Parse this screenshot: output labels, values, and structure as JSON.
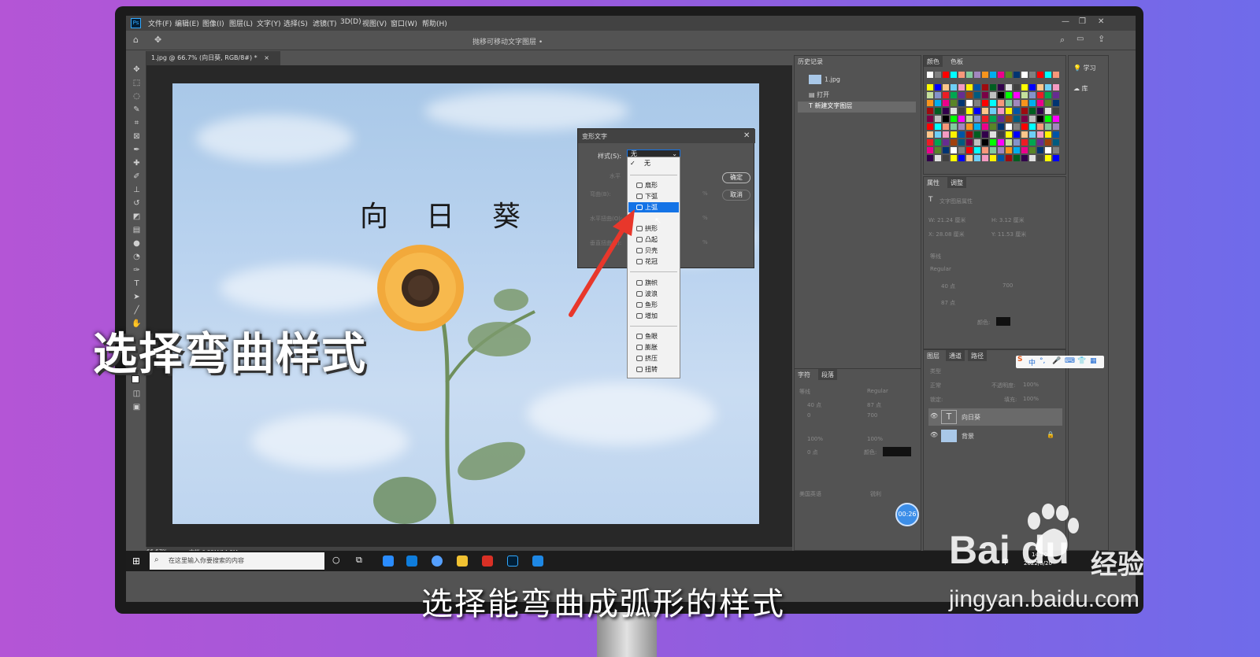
{
  "menubar": {
    "app_icon": "Ps",
    "items": [
      "文件(F)",
      "编辑(E)",
      "图像(I)",
      "图层(L)",
      "文字(Y)",
      "选择(S)",
      "滤镜(T)",
      "3D(D)",
      "视图(V)",
      "窗口(W)",
      "帮助(H)"
    ]
  },
  "optbar": {
    "center_title": "抛移可移动文字图层 •"
  },
  "document": {
    "tab_label": "1.jpg @ 66.7% (向日葵, RGB/8#) *",
    "canvas_text": "向日葵",
    "zoom": "66.67%",
    "doc_size": "文档:6.25M/14.2M"
  },
  "dialog": {
    "title": "变形文字",
    "style_label": "样式(S):",
    "style_value": "无",
    "ok": "确定",
    "cancel": "取消",
    "faded": [
      "水平",
      "弯曲(B):",
      "水平扭曲(O):",
      "垂直扭曲(E):",
      "%",
      "%",
      "%"
    ]
  },
  "dropdown": {
    "items": [
      {
        "label": "无",
        "checked": true
      },
      {
        "label": "扇形"
      },
      {
        "label": "下弧"
      },
      {
        "label": "上弧",
        "selected": true
      },
      {
        "label": "拱形"
      },
      {
        "label": "凸起"
      },
      {
        "label": "贝壳"
      },
      {
        "label": "花冠"
      },
      {
        "label": "旗帜"
      },
      {
        "label": "波浪"
      },
      {
        "label": "鱼形"
      },
      {
        "label": "增加"
      },
      {
        "label": "鱼眼"
      },
      {
        "label": "膨胀"
      },
      {
        "label": "挤压"
      },
      {
        "label": "扭转"
      }
    ]
  },
  "panels": {
    "history": {
      "tab": "历史记录",
      "items": [
        "1.jpg",
        "打开",
        "新建文字图层"
      ]
    },
    "swatches": {
      "tabs": [
        "颜色",
        "色板"
      ]
    },
    "learn": {
      "items": [
        "学习",
        "库"
      ]
    },
    "properties": {
      "tabs": [
        "属性",
        "调整"
      ],
      "section": "文字图层属性",
      "w": "W: 21.24 厘米",
      "h": "H: 3.12 厘米",
      "x": "X: 28.08 厘米",
      "y": "Y: 11.53 厘米",
      "font": "等线",
      "style": "Regular",
      "size": "40 点",
      "tracking": "700",
      "leading": "87 点",
      "color_label": "颜色:"
    },
    "character": {
      "tabs": [
        "字符",
        "段落"
      ],
      "font": "等线",
      "style": "Regular",
      "size": "40 点",
      "leading": "87 点",
      "kerning": "0",
      "tracking": "700",
      "vscale": "100%",
      "hscale": "100%",
      "baseline": "0 点",
      "color_label": "颜色:",
      "lang": "美国英语",
      "aa": "锐利"
    },
    "layers": {
      "tabs": [
        "图层",
        "通道",
        "路径"
      ],
      "search": "类型",
      "blend": "正常",
      "opacity_label": "不透明度:",
      "opacity": "100%",
      "lock_label": "锁定:",
      "fill_label": "填充:",
      "fill": "100%",
      "items": [
        {
          "name": "向日葵",
          "type": "text"
        },
        {
          "name": "背景",
          "type": "image"
        }
      ]
    }
  },
  "ime": {
    "items": [
      "中",
      "°,"
    ]
  },
  "taskbar": {
    "search_placeholder": "在这里输入你要搜索的内容",
    "clock_time": "14:20",
    "clock_date": "2022/8/20",
    "ime_label": "中"
  },
  "timer": "00:26",
  "overlays": {
    "caption_left": "选择弯曲样式",
    "subtitle": "选择能弯曲成弧形的样式",
    "watermark_logo": "Bai du",
    "watermark_word": "经验",
    "watermark_url": "jingyan.baidu.com"
  },
  "colors": {
    "accent": "#1473e6",
    "arrow": "#e8372b",
    "ps_dark": "#535353"
  }
}
